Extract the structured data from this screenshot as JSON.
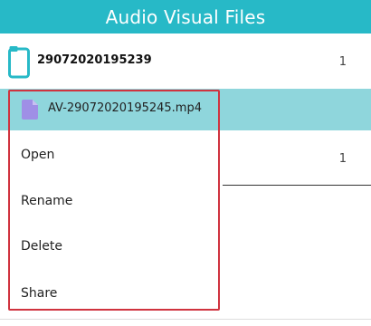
{
  "header": {
    "title": "Audio Visual Files"
  },
  "folder": {
    "name": "29072020195239",
    "count": "1"
  },
  "selected_file": {
    "name": "AV-29072020195245.mp4"
  },
  "second_row": {
    "count": "1"
  },
  "context_menu": {
    "items": [
      {
        "label": "Open"
      },
      {
        "label": "Rename"
      },
      {
        "label": "Delete"
      },
      {
        "label": "Share"
      }
    ]
  },
  "colors": {
    "accent": "#27b9c7",
    "selection": "#8fd6dc",
    "annotation": "#d0333f",
    "file_icon": "#9f8fe6"
  }
}
